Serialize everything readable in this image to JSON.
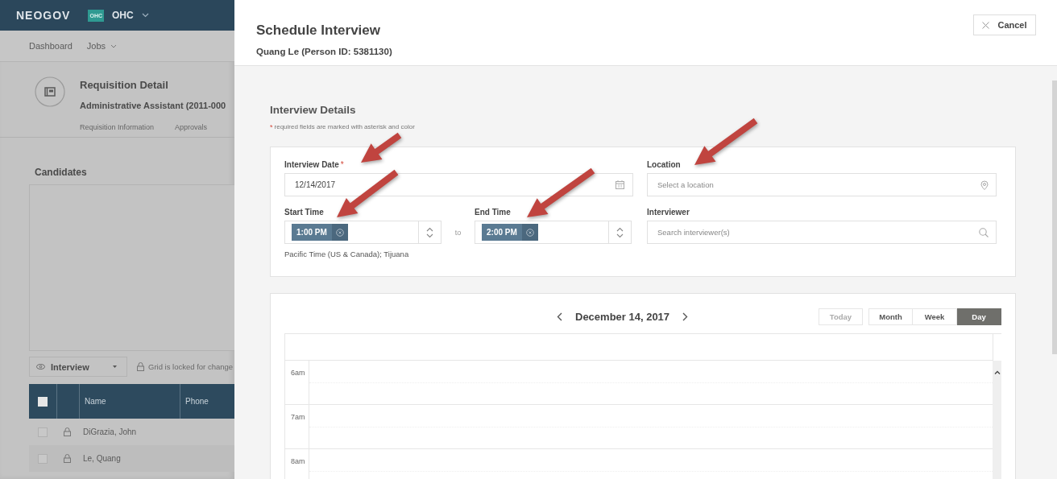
{
  "background_page": {
    "app_bar": {
      "brand": "NEOGOV",
      "org_badge": "OHC",
      "org": "OHC"
    },
    "nav": [
      {
        "label": "Dashboard",
        "has_menu": false
      },
      {
        "label": "Jobs",
        "has_menu": true
      }
    ],
    "requisition": {
      "title": "Requisition Detail",
      "subtitle": "Administrative Assistant (2011-000",
      "tabs": [
        "Requisition Information",
        "Approvals"
      ]
    },
    "candidates": {
      "title": "Candidates",
      "view_select": "Interview",
      "lock_note": "Grid is locked for change",
      "table": {
        "select_all_checked": false,
        "columns": [
          "Name",
          "Phone"
        ],
        "rows": [
          {
            "name": "DiGrazia, John",
            "checked": false
          },
          {
            "name": "Le, Quang",
            "checked": false
          }
        ]
      }
    }
  },
  "modal": {
    "title": "Schedule Interview",
    "subtitle": "Quang Le (Person ID: 5381130)",
    "cancel_button": "Cancel",
    "section_title": "Interview Details",
    "required_marker": "*",
    "required_note": "required fields are marked with asterisk and color",
    "interview_date": {
      "label": "Interview Date",
      "required": true,
      "value": "12/14/2017"
    },
    "location": {
      "label": "Location",
      "placeholder": "Select a location"
    },
    "start_time": {
      "label": "Start Time",
      "value": "1:00 PM"
    },
    "time_separator": "to",
    "end_time": {
      "label": "End Time",
      "value": "2:00 PM"
    },
    "interviewer": {
      "label": "Interviewer",
      "placeholder": "Search interviewer(s)"
    },
    "timezone": "Pacific Time (US & Canada); Tijuana",
    "calendar": {
      "date_label": "December 14, 2017",
      "today_button": {
        "label": "Today",
        "disabled": true
      },
      "views": [
        {
          "label": "Month",
          "selected": false
        },
        {
          "label": "Week",
          "selected": false
        },
        {
          "label": "Day",
          "selected": true
        }
      ],
      "hours": [
        "6am",
        "7am",
        "8am"
      ]
    }
  }
}
